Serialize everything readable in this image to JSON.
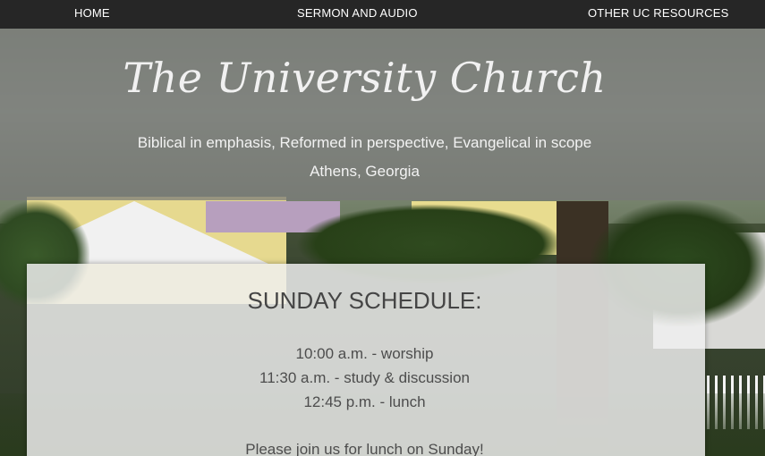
{
  "nav": {
    "items": [
      {
        "label": "HOME"
      },
      {
        "label": "SERMON AND AUDIO"
      },
      {
        "label": "OTHER UC RESOURCES"
      }
    ]
  },
  "header": {
    "title": "The University Church",
    "tagline": "Biblical in emphasis, Reformed in perspective, Evangelical in scope",
    "location": "Athens, Georgia"
  },
  "schedule": {
    "heading": "SUNDAY SCHEDULE:",
    "items": [
      "10:00 a.m. - worship",
      "11:30 a.m. - study & discussion",
      "12:45 p.m. - lunch"
    ],
    "note": "Please join us for lunch on Sunday!"
  },
  "colors": {
    "nav_background": "#262626",
    "header_overlay": "#787878",
    "panel_background": "#f0f0f0",
    "text_dark": "#454545",
    "text_light": "#f1f1f1"
  }
}
